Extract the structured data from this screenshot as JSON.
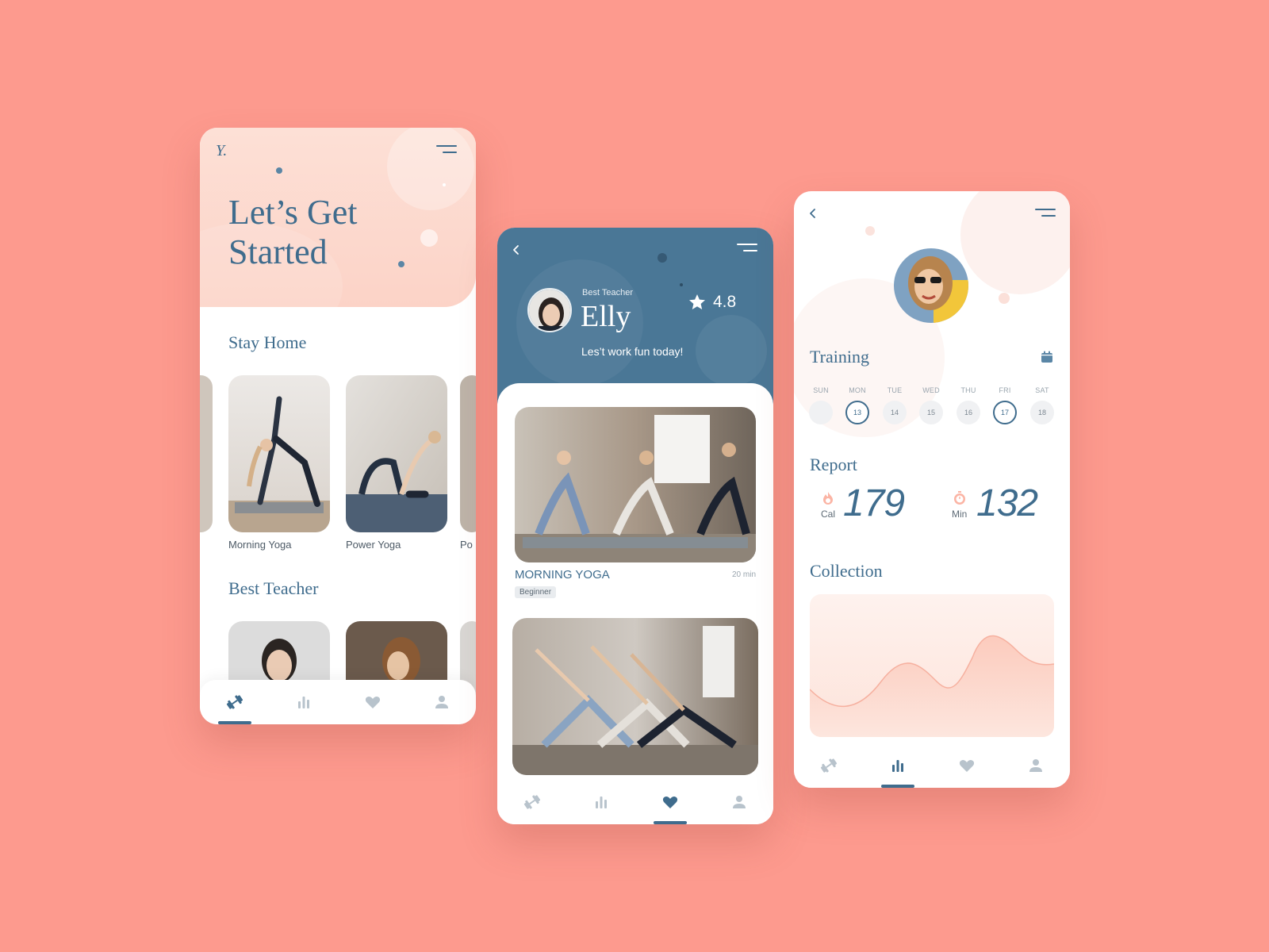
{
  "colors": {
    "background": "#fd9a8e",
    "navy": "#3f6c8d",
    "peach": "#fcd3c7",
    "header_blue": "#4a7796"
  },
  "screen1": {
    "logo": "Y.",
    "title": "Let’s Get Started",
    "stay_home_title": "Stay Home",
    "cards": [
      {
        "label": "Morning Yoga"
      },
      {
        "label": "Power Yoga"
      },
      {
        "label": "Po"
      }
    ],
    "best_teacher_title": "Best Teacher"
  },
  "screen2": {
    "teacher_caption": "Best Teacher",
    "teacher_name": "Elly",
    "rating": "4.8",
    "tagline": "Les’t work fun today!",
    "class_title": "MORNING YOGA",
    "class_duration": "20 min",
    "class_level": "Beginner"
  },
  "screen3": {
    "training_title": "Training",
    "days": [
      {
        "name": "SUN",
        "num": ""
      },
      {
        "name": "MON",
        "num": "13"
      },
      {
        "name": "TUE",
        "num": "14"
      },
      {
        "name": "WED",
        "num": "15"
      },
      {
        "name": "THU",
        "num": "16"
      },
      {
        "name": "FRI",
        "num": "17"
      },
      {
        "name": "SAT",
        "num": "18"
      }
    ],
    "report_title": "Report",
    "cal_label": "Cal",
    "cal_value": "179",
    "min_label": "Min",
    "min_value": "132",
    "collection_title": "Collection"
  },
  "nav_icons": [
    "dumbbell-icon",
    "bar-chart-icon",
    "heart-icon",
    "user-icon"
  ]
}
